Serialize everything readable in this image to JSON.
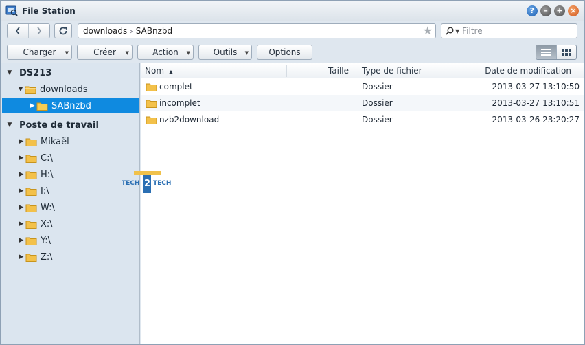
{
  "window": {
    "title": "File Station"
  },
  "path": {
    "segments": [
      "downloads",
      "SABnzbd"
    ],
    "separator": "›"
  },
  "search": {
    "placeholder": "Filtre"
  },
  "toolbar": {
    "charger": "Charger",
    "creer": "Créer",
    "action": "Action",
    "outils": "Outils",
    "options": "Options"
  },
  "tree": {
    "root1": "DS213",
    "downloads": "downloads",
    "sabnzbd": "SABnzbd",
    "root2": "Poste de travail",
    "items": [
      "Mikaël",
      "C:\\",
      "H:\\",
      "I:\\",
      "W:\\",
      "X:\\",
      "Y:\\",
      "Z:\\"
    ]
  },
  "columns": {
    "name": "Nom",
    "size": "Taille",
    "type": "Type de fichier",
    "modified": "Date de modification"
  },
  "files": [
    {
      "name": "complet",
      "type": "Dossier",
      "modified": "2013-03-27 13:10:50"
    },
    {
      "name": "incomplet",
      "type": "Dossier",
      "modified": "2013-03-27 13:10:51"
    },
    {
      "name": "nzb2download",
      "type": "Dossier",
      "modified": "2013-03-26 23:20:27"
    }
  ],
  "watermark": {
    "text_left": "TECH",
    "text_mid": "2",
    "text_right": "TECH"
  },
  "colors": {
    "selected": "#0f8ae0",
    "folder": "#f5c542",
    "tree_bg": "#dbe5ef"
  }
}
